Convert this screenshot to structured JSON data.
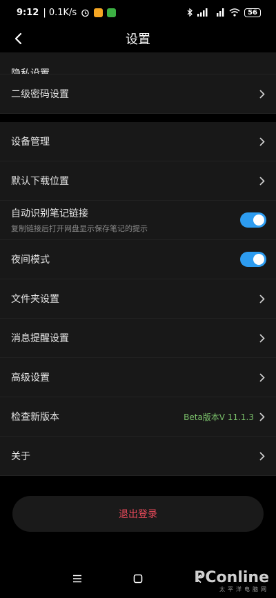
{
  "status_bar": {
    "time": "9:12",
    "net_speed": "| 0.1K/s",
    "signal": "4G",
    "battery": "56"
  },
  "header": {
    "title": "设置"
  },
  "groups": [
    {
      "items": [
        {
          "label": "隐私设置"
        },
        {
          "label": "二级密码设置"
        }
      ]
    },
    {
      "items": [
        {
          "label": "设备管理"
        },
        {
          "label": "默认下载位置"
        },
        {
          "label": "自动识别笔记链接",
          "sub": "复制链接后打开网盘显示保存笔记的提示",
          "toggle": "on"
        },
        {
          "label": "夜间模式",
          "toggle": "on"
        },
        {
          "label": "文件夹设置"
        },
        {
          "label": "消息提醒设置"
        },
        {
          "label": "高级设置"
        },
        {
          "label": "检查新版本",
          "value": "Beta版本V 11.1.3"
        },
        {
          "label": "关于"
        }
      ]
    }
  ],
  "logout_label": "退出登录",
  "watermark": {
    "logo": "PConline",
    "sub": "太平洋电脑网"
  },
  "colors": {
    "accent": "#2d9cf0",
    "danger": "#e8495a",
    "version": "#7bc26b"
  }
}
